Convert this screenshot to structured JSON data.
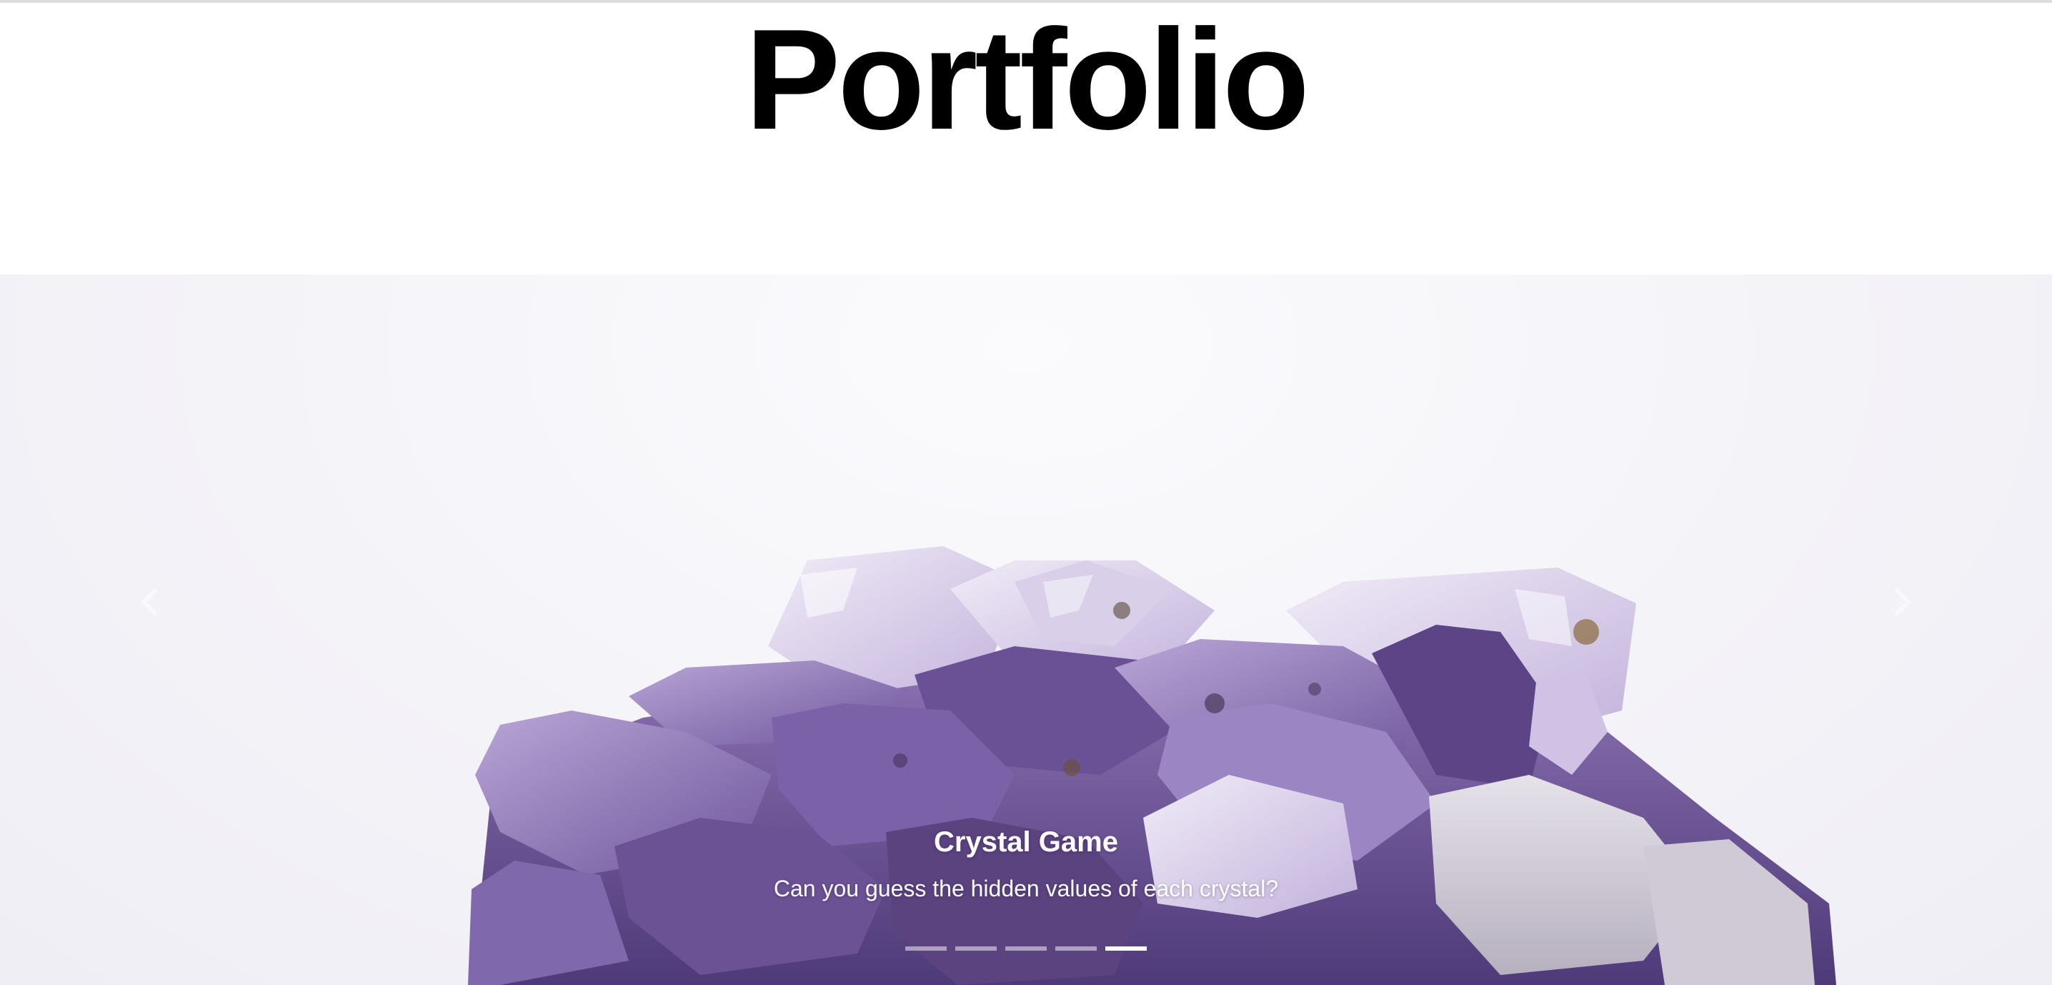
{
  "page": {
    "title": "Portfolio"
  },
  "carousel": {
    "slide": {
      "title": "Crystal Game",
      "description": "Can you guess the hidden values of each crystal?",
      "image_subject": "amethyst crystal cluster"
    },
    "controls": {
      "prev_icon": "chevron-left-icon",
      "next_icon": "chevron-right-icon"
    },
    "indicators": {
      "count": 5,
      "active_index": 4
    }
  },
  "colors": {
    "title": "#000000",
    "caption": "#ffffff",
    "background": "#ffffff"
  }
}
